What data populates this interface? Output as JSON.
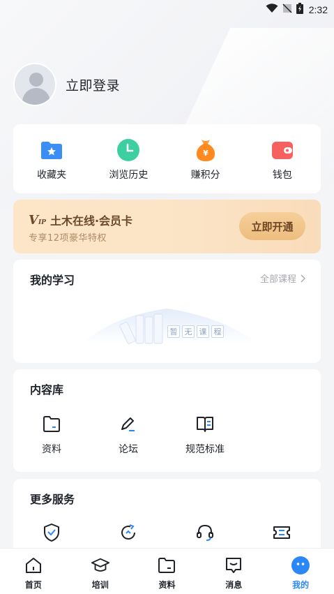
{
  "status_bar": {
    "time": "2:32"
  },
  "profile": {
    "login_label": "立即登录"
  },
  "quick_actions": [
    {
      "label": "收藏夹",
      "icon": "star-folder-icon",
      "color": "#3a8ef6"
    },
    {
      "label": "浏览历史",
      "icon": "clock-icon",
      "color": "#3dcf9f"
    },
    {
      "label": "赚积分",
      "icon": "money-bag-icon",
      "color": "#ff8a1f"
    },
    {
      "label": "钱包",
      "icon": "wallet-icon",
      "color": "#f6605f"
    }
  ],
  "vip": {
    "logo_text": "土木在线",
    "card_text": "·会员卡",
    "subtitle": "专享12项豪华特权",
    "button": "立即开通"
  },
  "study": {
    "title": "我的学习",
    "all_courses": "全部课程",
    "empty_chars": [
      "暂",
      "无",
      "课",
      "程"
    ]
  },
  "content_library": {
    "title": "内容库",
    "items": [
      {
        "label": "资料",
        "icon": "folder-icon"
      },
      {
        "label": "论坛",
        "icon": "pen-icon"
      },
      {
        "label": "规范标准",
        "icon": "book-icon"
      }
    ]
  },
  "more_services": {
    "title": "更多服务",
    "items": [
      {
        "icon": "shield-check-icon"
      },
      {
        "icon": "refresh-icon"
      },
      {
        "icon": "headset-icon"
      },
      {
        "icon": "ticket-icon"
      }
    ]
  },
  "tabbar": {
    "tabs": [
      {
        "label": "首页",
        "icon": "home-icon"
      },
      {
        "label": "培训",
        "icon": "graduation-cap-icon"
      },
      {
        "label": "资料",
        "icon": "folder-icon"
      },
      {
        "label": "消息",
        "icon": "message-icon"
      },
      {
        "label": "我的",
        "icon": "profile-face-icon",
        "active": true
      }
    ]
  },
  "colors": {
    "accent": "#2b86f6",
    "vip_text": "#6b4a2a"
  }
}
